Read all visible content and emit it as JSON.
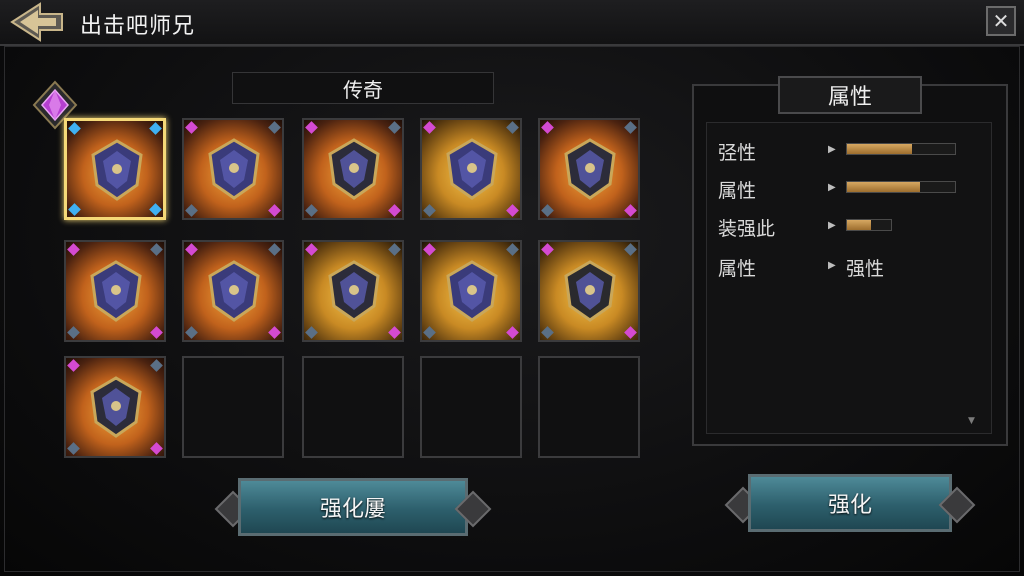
{
  "header": {
    "title": "出击吧师兄"
  },
  "section": {
    "title": "传奇"
  },
  "grid": {
    "slots": [
      {
        "name": "shield",
        "filled": true,
        "selected": true
      },
      {
        "name": "blade",
        "filled": true
      },
      {
        "name": "armor",
        "filled": true
      },
      {
        "name": "shield",
        "filled": true,
        "gold": true
      },
      {
        "name": "helmet",
        "filled": true
      },
      {
        "name": "vase-armor",
        "filled": true
      },
      {
        "name": "gauntlet",
        "filled": true
      },
      {
        "name": "warrior",
        "filled": true,
        "gold": true
      },
      {
        "name": "shield",
        "filled": true,
        "gold": true
      },
      {
        "name": "beast",
        "filled": true,
        "gold": true
      },
      {
        "name": "armor",
        "filled": true
      },
      {
        "name": "empty",
        "filled": false
      },
      {
        "name": "empty",
        "filled": false
      },
      {
        "name": "empty",
        "filled": false
      },
      {
        "name": "empty",
        "filled": false
      }
    ]
  },
  "panel": {
    "title": "属性",
    "stats": [
      {
        "label": "弪性",
        "bar": 0.6
      },
      {
        "label": "属性",
        "bar": 0.68
      },
      {
        "label": "装强此",
        "bar": 0.55
      },
      {
        "label": "属性",
        "text": "强性"
      }
    ]
  },
  "buttons": {
    "left_label": "强化屢",
    "right_label": "强化"
  }
}
